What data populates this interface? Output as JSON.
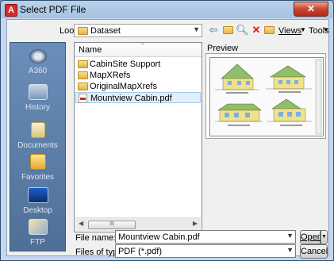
{
  "window": {
    "app_icon": "A",
    "title": "Select PDF File",
    "close_glyph": "✕"
  },
  "lookin": {
    "label": "Look in:",
    "value": "Dataset"
  },
  "toolbar": {
    "views_label": "Views",
    "tools_label": "Tools"
  },
  "places": [
    {
      "label": "A360",
      "icon": "cloud-icon"
    },
    {
      "label": "History",
      "icon": "history-icon"
    },
    {
      "label": "Documents",
      "icon": "documents-icon"
    },
    {
      "label": "Favorites",
      "icon": "favorites-icon"
    },
    {
      "label": "Desktop",
      "icon": "desktop-icon"
    },
    {
      "label": "FTP",
      "icon": "ftp-icon"
    }
  ],
  "filelist": {
    "column_name": "Name",
    "items": [
      {
        "name": "CabinSite Support",
        "type": "folder"
      },
      {
        "name": "MapXRefs",
        "type": "folder"
      },
      {
        "name": "OriginalMapXrefs",
        "type": "folder"
      },
      {
        "name": "Mountview Cabin.pdf",
        "type": "pdf",
        "selected": true
      }
    ],
    "scroll_thumb": "III"
  },
  "preview": {
    "label": "Preview"
  },
  "filename": {
    "label": "File name:",
    "value": "Mountview Cabin.pdf"
  },
  "filetype": {
    "label": "Files of type:",
    "value": "PDF (*.pdf)"
  },
  "buttons": {
    "open": "Open",
    "cancel": "Cancel"
  },
  "colors": {
    "title_bar": "#b9d1ea",
    "places_bar": "#5b7ea8",
    "selection": "#e3eefb"
  }
}
